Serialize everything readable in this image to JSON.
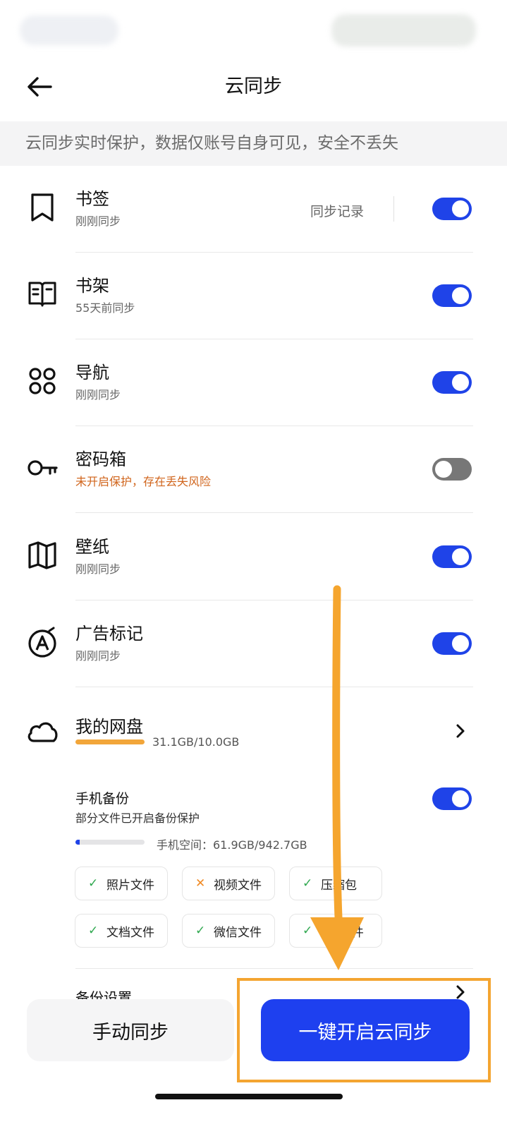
{
  "header": {
    "title": "云同步",
    "back_icon": "arrow-left-icon"
  },
  "banner": {
    "text": "云同步实时保护，数据仅账号自身可见，安全不丢失"
  },
  "items": [
    {
      "id": "bookmarks",
      "title": "书签",
      "subtitle": "刚刚同步",
      "icon": "bookmark-icon",
      "enabled": true,
      "extra_link": "同步记录"
    },
    {
      "id": "bookshelf",
      "title": "书架",
      "subtitle": "55天前同步",
      "icon": "book-icon",
      "enabled": true
    },
    {
      "id": "navigation",
      "title": "导航",
      "subtitle": "刚刚同步",
      "icon": "grid-dots-icon",
      "enabled": true
    },
    {
      "id": "passwords",
      "title": "密码箱",
      "subtitle": "未开启保护，存在丢失风险",
      "icon": "key-icon",
      "enabled": false,
      "warning": true
    },
    {
      "id": "wallpaper",
      "title": "壁纸",
      "subtitle": "刚刚同步",
      "icon": "map-icon",
      "enabled": true
    },
    {
      "id": "ad-marks",
      "title": "广告标记",
      "subtitle": "刚刚同步",
      "icon": "ad-mark-icon",
      "enabled": true
    }
  ],
  "netdisk": {
    "title": "我的网盘",
    "icon": "cloud-icon",
    "usage": "31.1GB/10.0GB",
    "usage_fraction": 1.0,
    "bar_color": "#f2a63a"
  },
  "backup": {
    "title": "手机备份",
    "subtitle": "部分文件已开启备份保护",
    "enabled": true,
    "phone_space": "手机空间：61.9GB/942.7GB",
    "phone_fraction": 0.066,
    "file_types": [
      {
        "label": "照片文件",
        "status": "ok"
      },
      {
        "label": "视频文件",
        "status": "no"
      },
      {
        "label": "压缩包",
        "status": "ok"
      },
      {
        "label": "文档文件",
        "status": "ok"
      },
      {
        "label": "微信文件",
        "status": "ok"
      },
      {
        "label": "QQ文件",
        "status": "ok"
      }
    ],
    "settings_label": "备份设置"
  },
  "actions": {
    "manual_sync": "手动同步",
    "one_click_sync": "一键开启云同步"
  },
  "colors": {
    "accent": "#1e40ef",
    "toggle_off": "#777777",
    "warning_text": "#d0641b",
    "annotation": "#f4a531"
  }
}
